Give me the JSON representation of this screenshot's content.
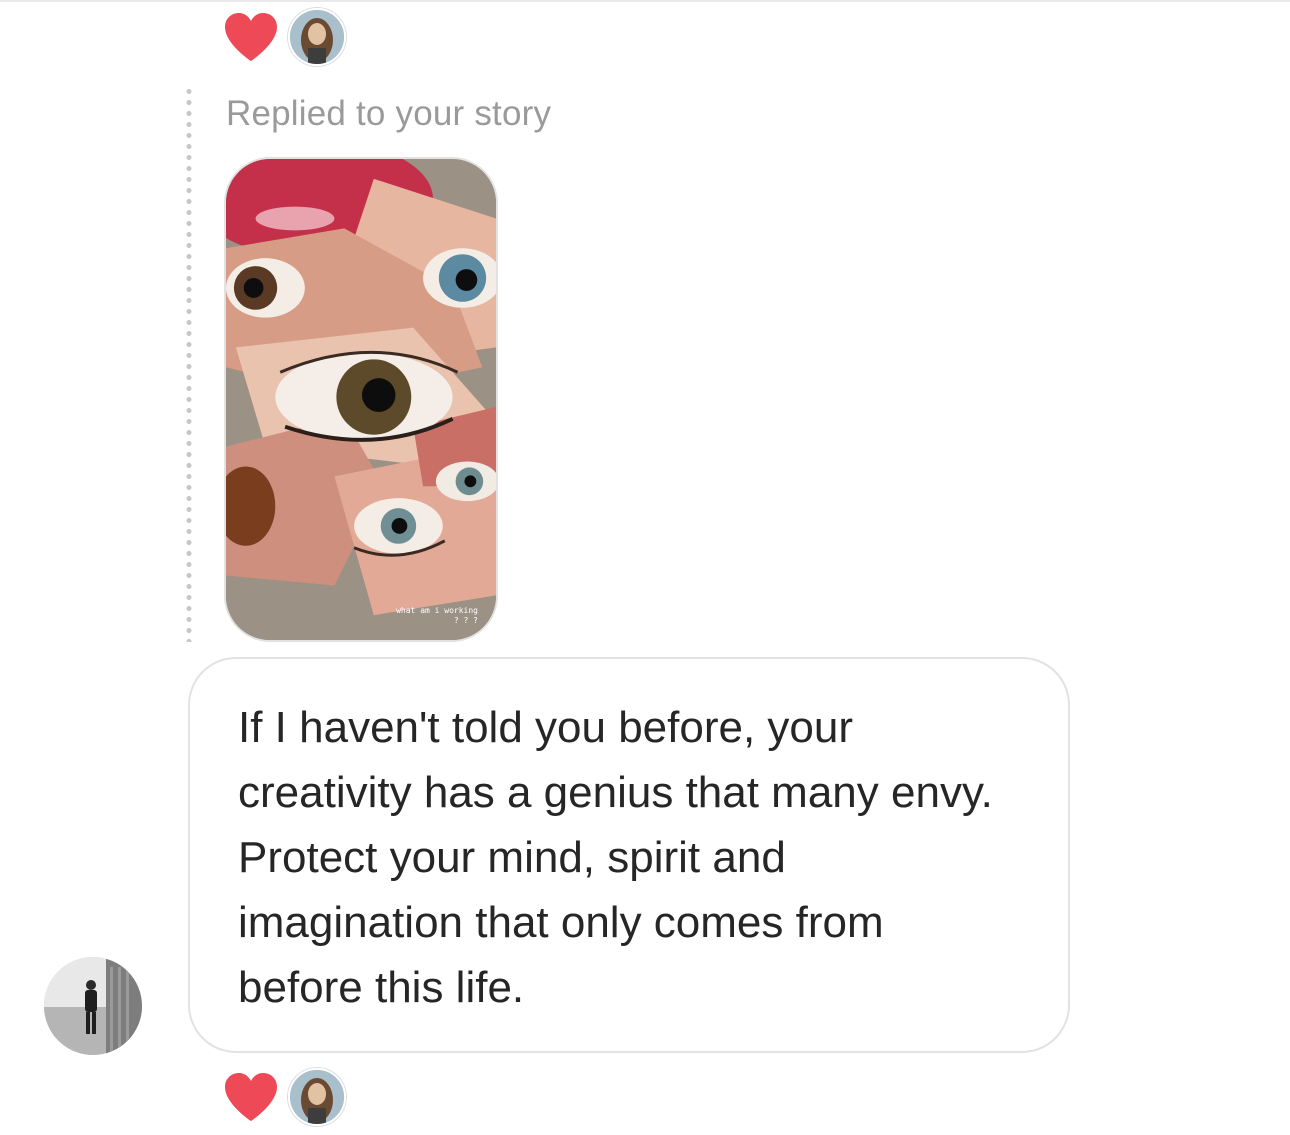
{
  "colors": {
    "heart": "#ed4956",
    "caption_gray": "#9a9a9a",
    "message_text": "#262626",
    "bubble_border": "#e2e2e2",
    "reply_dots": "#c8c8c8"
  },
  "top_reaction": {
    "icon": "heart-icon",
    "reactor_avatar": "reactor-avatar"
  },
  "story_reply": {
    "caption": "Replied to your story",
    "story_image_icon": "story-thumbnail",
    "story_overlay_text": "what am i working\n? ? ?"
  },
  "message": {
    "text": "If I haven't told you before, your creativity has a genius that many envy. Protect your mind, spirit and imagination that only comes from before this life.",
    "sender_avatar": "sender-avatar"
  },
  "bottom_reaction": {
    "icon": "heart-icon",
    "reactor_avatar": "reactor-avatar"
  }
}
